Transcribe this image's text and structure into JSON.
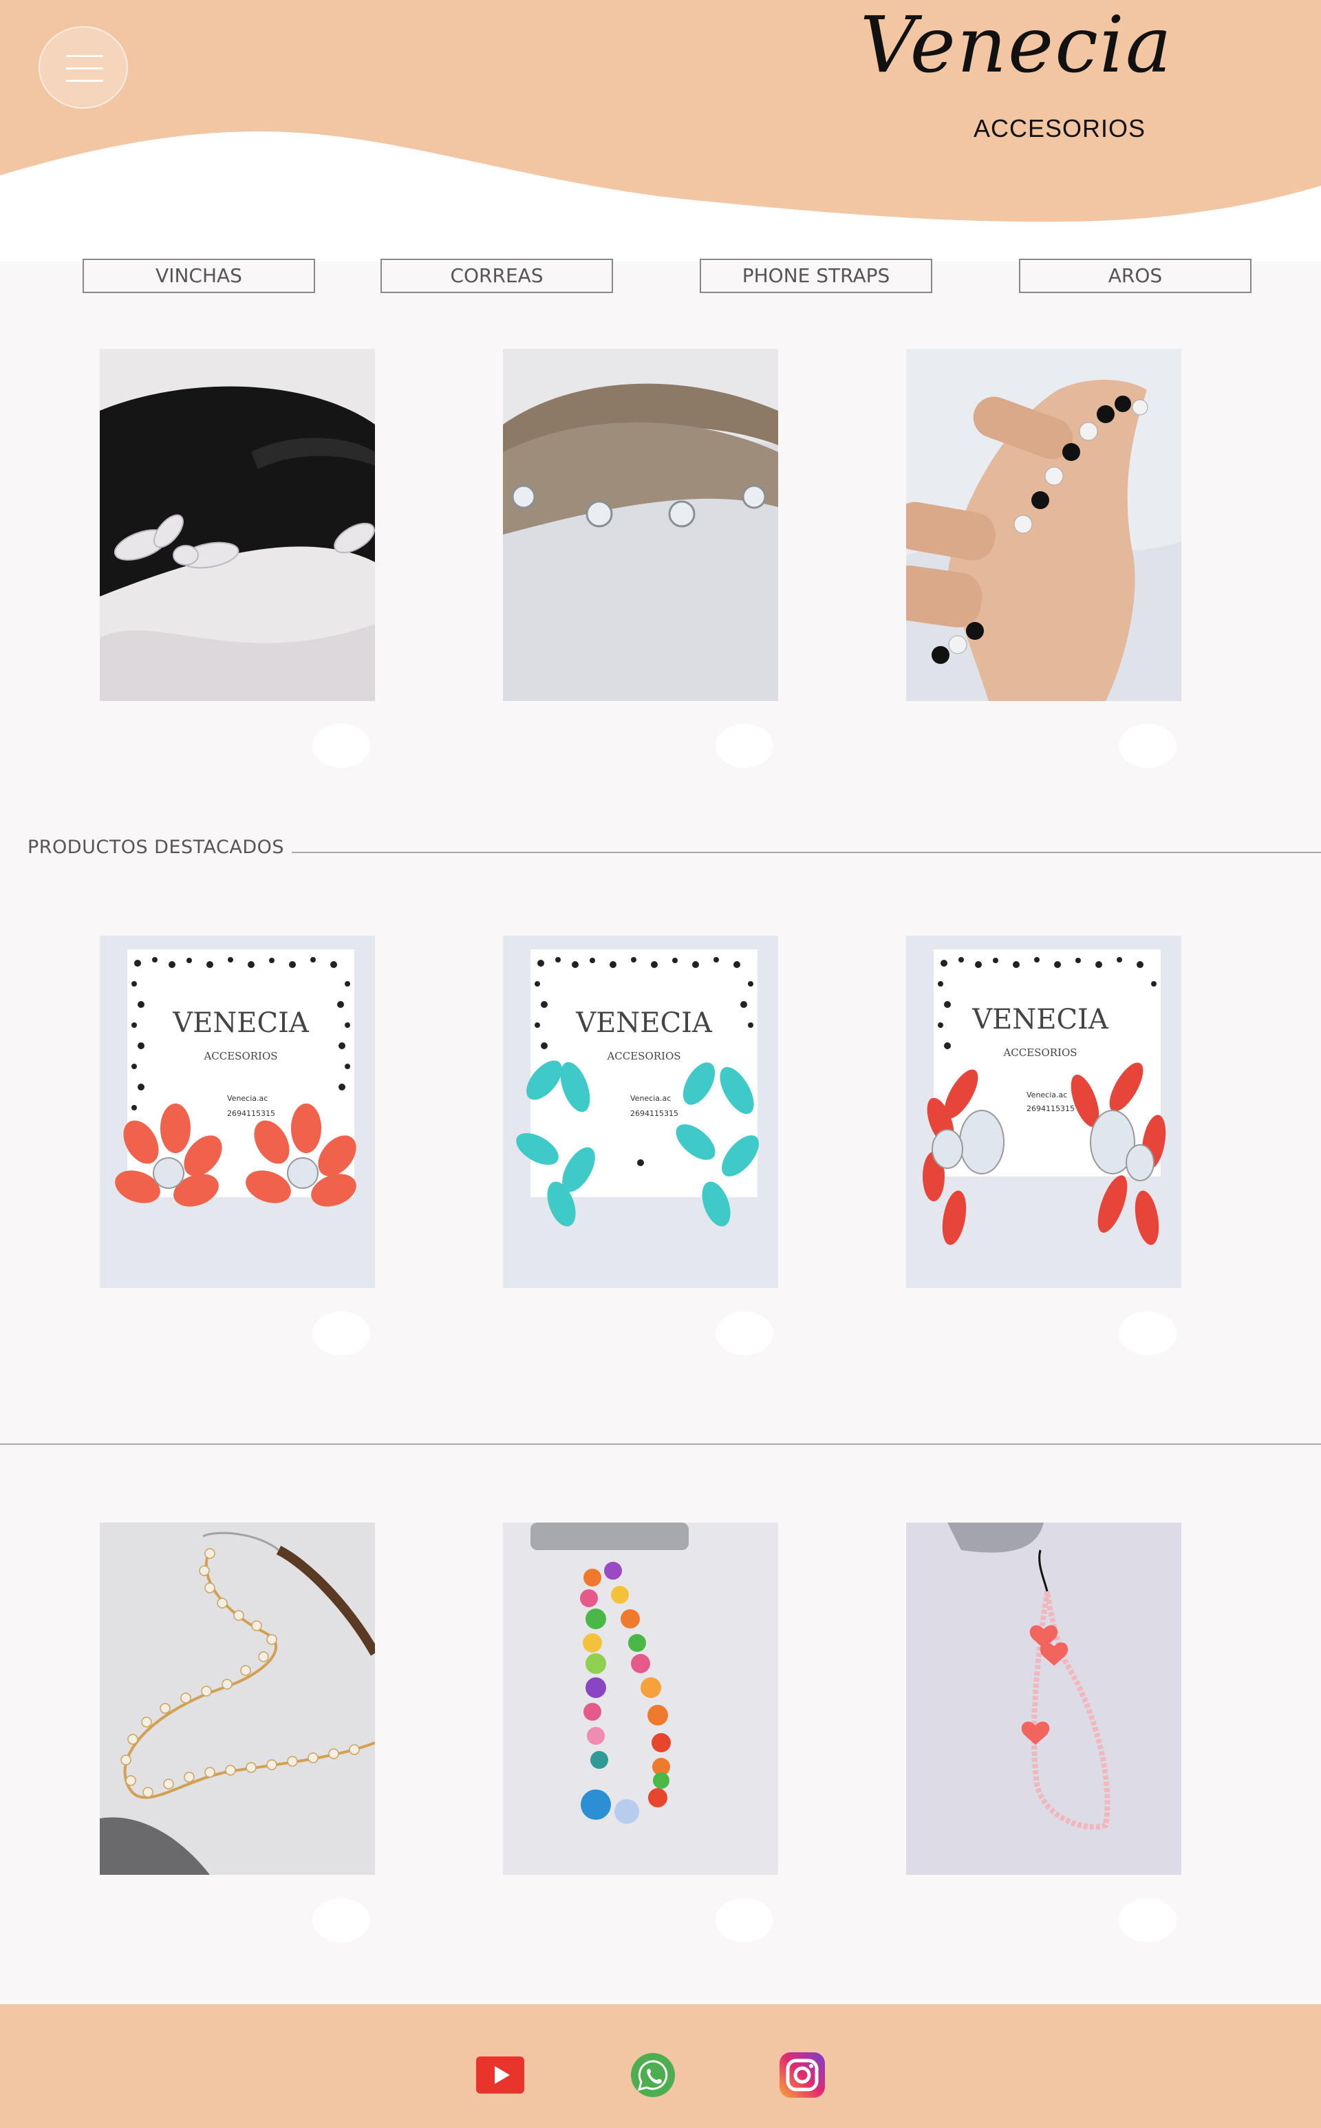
{
  "brand": {
    "name": "Venecia",
    "tagline": "ACCESORIOS"
  },
  "nav": {
    "categories": [
      "VINCHAS",
      "CORREAS",
      "PHONE STRAPS",
      "AROS"
    ]
  },
  "sections": {
    "featured_title": "PRODUCTOS DESTACADOS"
  },
  "card_brand": {
    "name": "VENECIA",
    "sub": "ACCESORIOS",
    "instagram": "Venecia.ac",
    "phone": "2694115315"
  },
  "icons": {
    "menu": "hamburger-icon",
    "youtube": "youtube-icon",
    "whatsapp": "whatsapp-icon",
    "instagram": "instagram-icon"
  },
  "colors": {
    "peach": "#f2c6a3",
    "page_bg": "#f9f7f7",
    "youtube_red": "#e9342c",
    "whatsapp_green": "#4cae4f",
    "instagram_pink": "#d6266f"
  }
}
